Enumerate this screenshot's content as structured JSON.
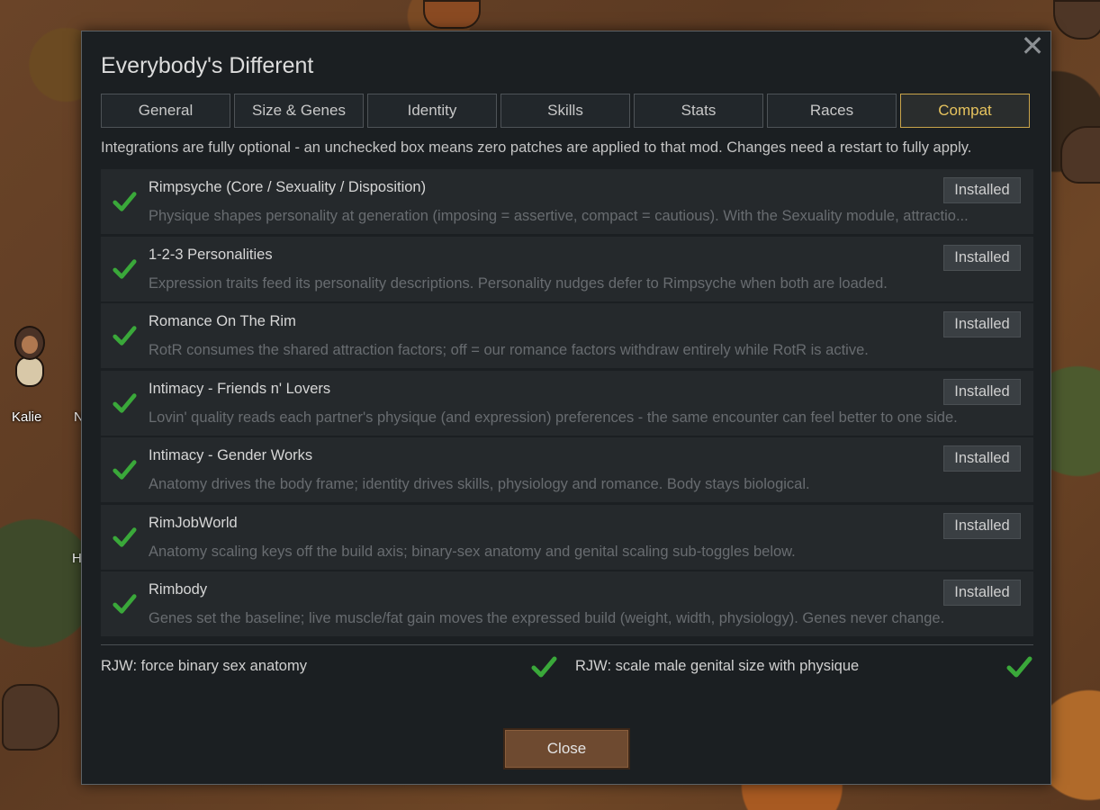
{
  "background": {
    "pawn_name": "Kalie",
    "partial_label_1": "N",
    "partial_label_2": "H"
  },
  "dialog": {
    "title": "Everybody's Different",
    "close_icon": "close-icon",
    "tabs": [
      {
        "label": "General",
        "active": false
      },
      {
        "label": "Size & Genes",
        "active": false
      },
      {
        "label": "Identity",
        "active": false
      },
      {
        "label": "Skills",
        "active": false
      },
      {
        "label": "Stats",
        "active": false
      },
      {
        "label": "Races",
        "active": false
      },
      {
        "label": "Compat",
        "active": true
      }
    ],
    "intro": "Integrations are fully optional - an unchecked box means zero patches are applied to that mod. Changes need a restart to fully apply.",
    "mods": [
      {
        "name": "Rimpsyche (Core / Sexuality / Disposition)",
        "description": "Physique shapes personality at generation (imposing = assertive, compact = cautious). With the Sexuality module, attractio...",
        "status": "Installed",
        "enabled": true
      },
      {
        "name": "1-2-3 Personalities",
        "description": "Expression traits feed its personality descriptions. Personality nudges defer to Rimpsyche when both are loaded.",
        "status": "Installed",
        "enabled": true
      },
      {
        "name": "Romance On The Rim",
        "description": "RotR consumes the shared attraction factors; off = our romance factors withdraw entirely while RotR is active.",
        "status": "Installed",
        "enabled": true
      },
      {
        "name": "Intimacy - Friends n' Lovers",
        "description": "Lovin' quality reads each partner's physique (and expression) preferences - the same encounter can feel better to one side.",
        "status": "Installed",
        "enabled": true
      },
      {
        "name": "Intimacy - Gender Works",
        "description": "Anatomy drives the body frame; identity drives skills, physiology and romance. Body stays biological.",
        "status": "Installed",
        "enabled": true
      },
      {
        "name": "RimJobWorld",
        "description": "Anatomy scaling keys off the build axis; binary-sex anatomy and genital scaling sub-toggles below.",
        "status": "Installed",
        "enabled": true
      },
      {
        "name": "Rimbody",
        "description": "Genes set the baseline; live muscle/fat gain moves the expressed build (weight, width, physiology). Genes never change.",
        "status": "Installed",
        "enabled": true
      }
    ],
    "options": [
      {
        "label": "RJW: force binary sex anatomy",
        "enabled": true
      },
      {
        "label": "RJW: scale male genital size with physique",
        "enabled": true
      }
    ],
    "close_label": "Close"
  },
  "colors": {
    "panel": "#1b1f22",
    "row": "#25292c",
    "accent_tab": "#e6c35e",
    "check": "#3aa83a",
    "close_button": "#6e4a30"
  }
}
